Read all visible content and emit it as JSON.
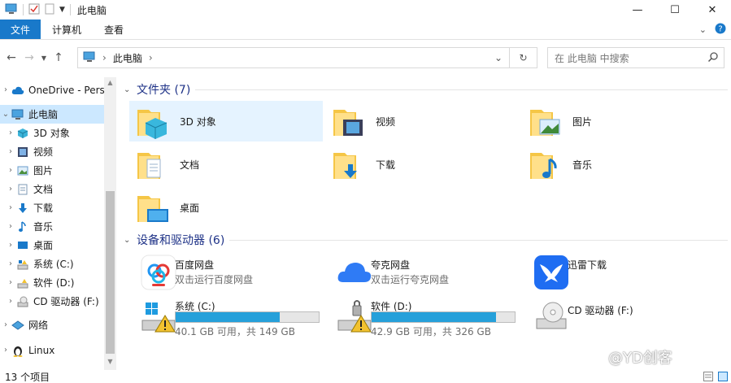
{
  "window": {
    "title": "此电脑",
    "controls": {
      "minimize": "—",
      "maximize": "☐",
      "close": "✕"
    }
  },
  "ribbon": {
    "tabs": [
      "文件",
      "计算机",
      "查看"
    ]
  },
  "address": {
    "breadcrumb": [
      "此电脑"
    ],
    "search_placeholder": "在 此电脑 中搜索"
  },
  "nav": {
    "items": [
      {
        "label": "OneDrive - Personal",
        "icon": "cloud-icon"
      },
      {
        "label": "此电脑",
        "icon": "pc-icon"
      },
      {
        "label": "3D 对象",
        "icon": "3d-objects-icon"
      },
      {
        "label": "视频",
        "icon": "video-icon"
      },
      {
        "label": "图片",
        "icon": "picture-icon"
      },
      {
        "label": "文档",
        "icon": "document-icon"
      },
      {
        "label": "下载",
        "icon": "download-icon"
      },
      {
        "label": "音乐",
        "icon": "music-icon"
      },
      {
        "label": "桌面",
        "icon": "desktop-icon"
      },
      {
        "label": "系统 (C:)",
        "icon": "drive-icon"
      },
      {
        "label": "软件 (D:)",
        "icon": "drive-icon"
      },
      {
        "label": "CD 驱动器 (F:)",
        "icon": "cd-drive-icon"
      },
      {
        "label": "网络",
        "icon": "network-icon"
      },
      {
        "label": "Linux",
        "icon": "linux-icon"
      }
    ]
  },
  "folders_group": {
    "title": "文件夹 (7)",
    "items": [
      {
        "label": "3D 对象",
        "icon": "3d-objects-icon"
      },
      {
        "label": "视频",
        "icon": "video-icon"
      },
      {
        "label": "图片",
        "icon": "picture-icon"
      },
      {
        "label": "文档",
        "icon": "document-icon"
      },
      {
        "label": "下载",
        "icon": "download-icon"
      },
      {
        "label": "音乐",
        "icon": "music-icon"
      },
      {
        "label": "桌面",
        "icon": "desktop-icon"
      }
    ]
  },
  "devices_group": {
    "title": "设备和驱动器 (6)",
    "apps": [
      {
        "name": "百度网盘",
        "sub": "双击运行百度网盘",
        "icon": "baidu-netdisk-icon"
      },
      {
        "name": "夸克网盘",
        "sub": "双击运行夸克网盘",
        "icon": "quark-netdisk-icon"
      },
      {
        "name": "迅雷下载",
        "sub": "",
        "icon": "xunlei-icon"
      }
    ],
    "drives": [
      {
        "name": "系统 (C:)",
        "free": "40.1 GB 可用，共 149 GB",
        "used_fraction": 0.73,
        "icon": "windows-drive-warning-icon"
      },
      {
        "name": "软件 (D:)",
        "free": "42.9 GB 可用，共 326 GB",
        "used_fraction": 0.87,
        "icon": "drive-warning-icon"
      },
      {
        "name": "CD 驱动器 (F:)",
        "free": "",
        "icon": "cd-drive-icon"
      }
    ]
  },
  "status": {
    "count": "13 个项目"
  },
  "watermark": "@YD创客",
  "colors": {
    "accent": "#1979ca",
    "selection": "#cce8ff",
    "group_title": "#1e3287",
    "drive_fill": "#26a0da"
  }
}
